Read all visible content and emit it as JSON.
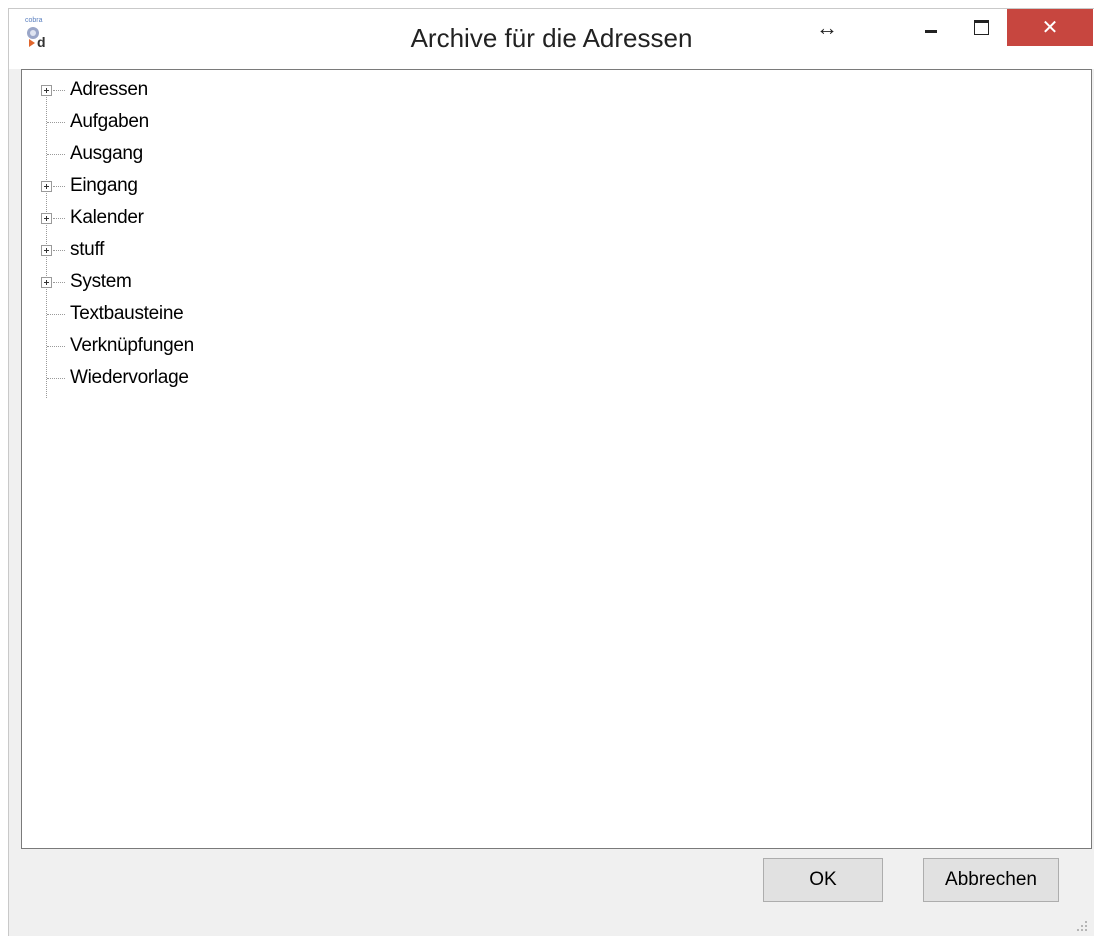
{
  "window": {
    "title": "Archive für die Adressen",
    "app_icon_text": "cobra",
    "close_glyph": "✕",
    "resize_glyph": "↔"
  },
  "tree": {
    "items": [
      {
        "label": "Adressen",
        "expandable": true
      },
      {
        "label": "Aufgaben",
        "expandable": false
      },
      {
        "label": "Ausgang",
        "expandable": false
      },
      {
        "label": "Eingang",
        "expandable": true
      },
      {
        "label": "Kalender",
        "expandable": true
      },
      {
        "label": "stuff",
        "expandable": true
      },
      {
        "label": "System",
        "expandable": true
      },
      {
        "label": "Textbausteine",
        "expandable": false
      },
      {
        "label": "Verknüpfungen",
        "expandable": false
      },
      {
        "label": "Wiedervorlage",
        "expandable": false
      }
    ]
  },
  "buttons": {
    "ok": "OK",
    "cancel": "Abbrechen"
  },
  "colors": {
    "close_button": "#c7463f",
    "background": "#f0f0f0",
    "panel": "#ffffff"
  }
}
